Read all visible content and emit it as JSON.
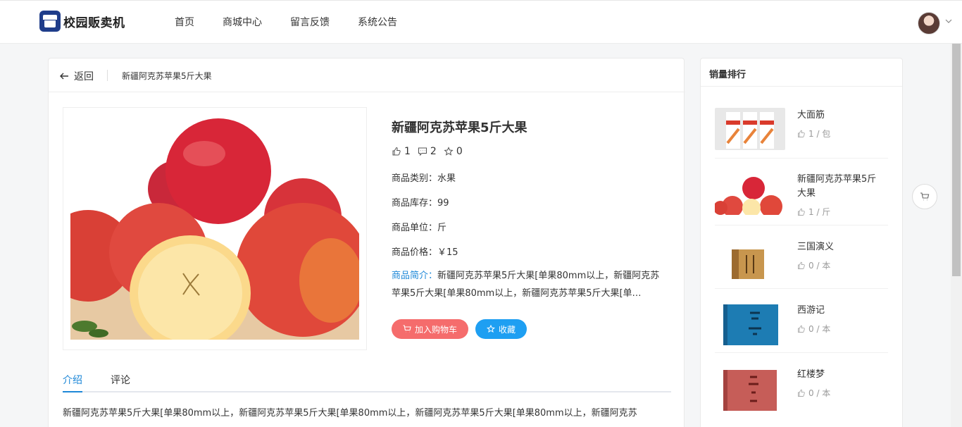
{
  "header": {
    "app_title": "校园贩卖机",
    "nav": [
      "首页",
      "商城中心",
      "留言反馈",
      "系统公告"
    ]
  },
  "breadcrumb": {
    "back_label": "返回",
    "current": "新疆阿克苏苹果5斤大果"
  },
  "product": {
    "title": "新疆阿克苏苹果5斤大果",
    "stats": {
      "likes": "1",
      "comments": "2",
      "favorites": "0"
    },
    "category_label": "商品类别：",
    "category": "水果",
    "stock_label": "商品库存：",
    "stock": "99",
    "unit_label": "商品单位：",
    "unit": "斤",
    "price_label": "商品价格：",
    "price": "￥15",
    "desc_label": "商品简介：",
    "desc": "新疆阿克苏苹果5斤大果[单果80mm以上，新疆阿克苏苹果5斤大果[单果80mm以上，新疆阿克苏苹果5斤大果[单…",
    "add_cart_label": "加入购物车",
    "favorite_label": "收藏"
  },
  "tabs": {
    "intro": "介绍",
    "comments": "评论",
    "active": "介绍"
  },
  "intro_text": "新疆阿克苏苹果5斤大果[单果80mm以上，新疆阿克苏苹果5斤大果[单果80mm以上，新疆阿克苏苹果5斤大果[单果80mm以上，新疆阿克苏",
  "ranking": {
    "title": "销量排行",
    "items": [
      {
        "name": "大面筋",
        "meta": "1 / 包"
      },
      {
        "name": "新疆阿克苏苹果5斤大果",
        "meta": "1 / 斤"
      },
      {
        "name": "三国演义",
        "meta": "0 / 本"
      },
      {
        "name": "西游记",
        "meta": "0 / 本"
      },
      {
        "name": "红楼梦",
        "meta": "0 / 本"
      }
    ]
  },
  "colors": {
    "accent": "#1e88d8",
    "cart_button": "#f56c6c",
    "favorite_button": "#1e9ff2",
    "brand_logo": "#1f3d8a"
  }
}
